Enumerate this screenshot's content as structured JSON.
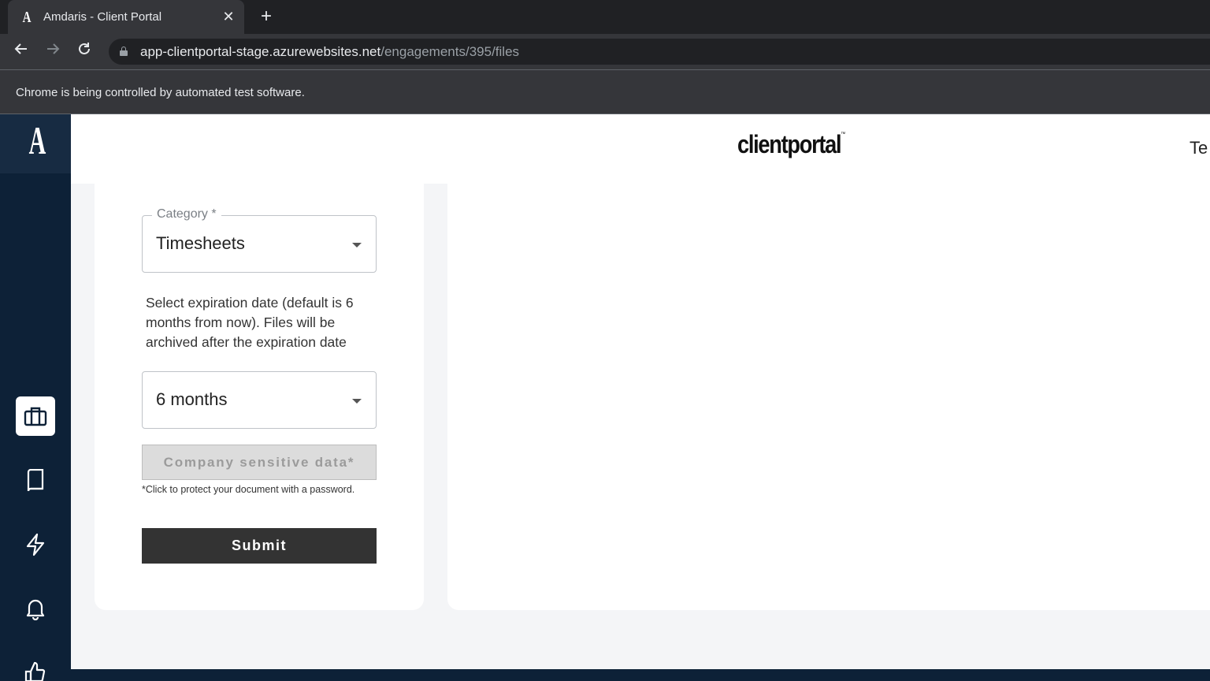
{
  "browser": {
    "tab_title": "Amdaris - Client Portal",
    "tab_favicon": "A",
    "tab_close": "✕",
    "new_tab": "+",
    "url_host": "app-clientportal-stage.azurewebsites.net",
    "url_path": "/engagements/395/files",
    "infobar_text": "Chrome is being controlled by automated test software."
  },
  "sidebar": {
    "logo": "A",
    "items": [
      {
        "icon": "briefcase-icon",
        "active": true
      },
      {
        "icon": "book-icon",
        "active": false
      },
      {
        "icon": "lightning-icon",
        "active": false
      },
      {
        "icon": "bell-icon",
        "active": false
      },
      {
        "icon": "thumbs-up-icon",
        "active": false
      }
    ]
  },
  "header": {
    "brand": "clientportal",
    "brand_tm": "™",
    "user_text": "Te"
  },
  "form": {
    "category_label": "Category *",
    "category_value": "Timesheets",
    "expiration_help": "Select expiration date (default is 6 months from now). Files will be archived after the expiration date",
    "expiration_value": "6 months",
    "sensitive_label": "Company sensitive data*",
    "sensitive_hint": "*Click to protect your document with a password.",
    "submit_label": "Submit"
  },
  "colors": {
    "sidebar_bg": "#0d2137",
    "submit_bg": "#333333",
    "page_bg": "#f4f5f7"
  }
}
